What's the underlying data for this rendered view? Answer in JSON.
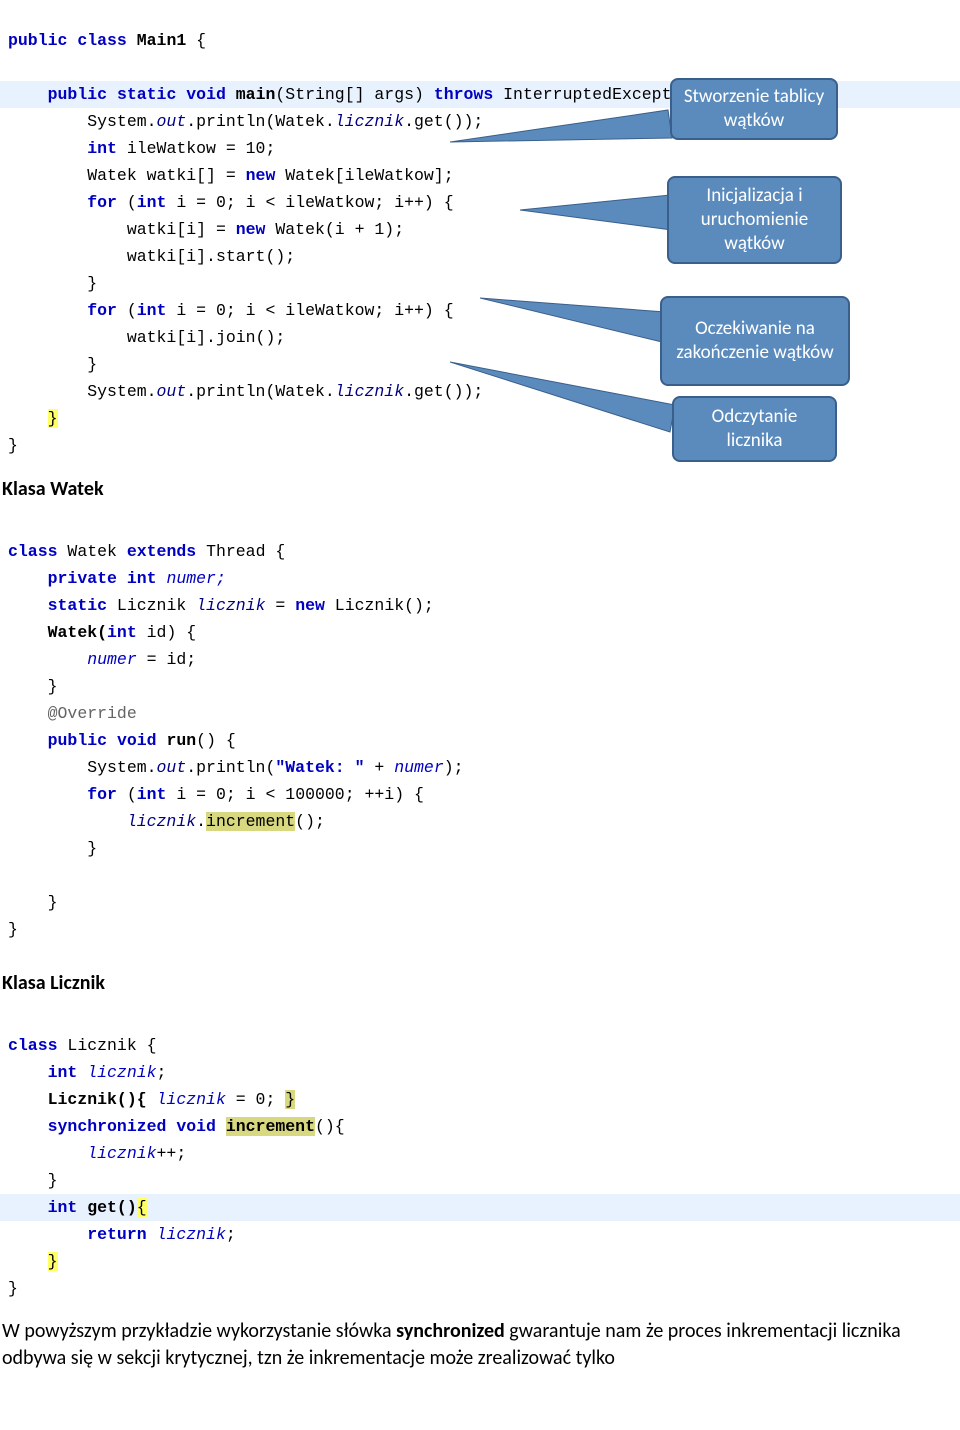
{
  "code_block_1": {
    "classDecl": {
      "kw1": "public",
      "kw2": "class",
      "name": "Main1"
    },
    "methodSig": {
      "kw1": "public",
      "kw2": "static",
      "kw3": "void",
      "name": "main",
      "argsPre": "(String[] args)",
      "throwsKw": "throws",
      "ex": "InterruptedException"
    },
    "l1": {
      "p1": "System.",
      "out": "out",
      "p2": ".println(Watek.",
      "lic": "licznik",
      "p3": ".get());"
    },
    "l2": {
      "kw": "int",
      "rest": " ileWatkow = 10;"
    },
    "l3": {
      "p1": "Watek watki[] = ",
      "kw": "new",
      "p2": " Watek[ileWatkow];"
    },
    "l4": {
      "kw1": "for",
      "p1": " (",
      "kw2": "int",
      "p2": " i = 0; i < ileWatkow; i++) {"
    },
    "l5": {
      "p1": "watki[i] = ",
      "kw": "new",
      "p2": " Watek(i + 1);"
    },
    "l6": {
      "txt": "watki[i].start();"
    },
    "l7": {
      "txt": "}"
    },
    "l8": {
      "kw1": "for",
      "p1": " (",
      "kw2": "int",
      "p2": " i = 0; i < ileWatkow; i++) {"
    },
    "l9": {
      "txt": "watki[i].join();"
    },
    "l10": {
      "txt": "}"
    },
    "l11": {
      "p1": "System.",
      "out": "out",
      "p2": ".println(Watek.",
      "lic": "licznik",
      "p3": ".get());"
    },
    "l12": {
      "txt": "}"
    },
    "l13": {
      "txt": "}"
    }
  },
  "section1": "Klasa Watek",
  "code_block_2": {
    "classDecl": {
      "kw": "class",
      "name": "Watek",
      "ext": "extends",
      "sup": "Thread"
    },
    "l1": {
      "kw1": "private",
      "kw2": "int",
      "name": " numer;"
    },
    "l2": {
      "kw": "static",
      "type": " Licznik ",
      "lic": "licznik",
      "rest": " = ",
      "kwNew": "new",
      "rest2": " Licznik();"
    },
    "l3": {
      "p1": "Watek(",
      "kw": "int",
      "p2": " id) {"
    },
    "l4": {
      "fld": "numer",
      "rest": " = id;"
    },
    "l5": {
      "txt": "}"
    },
    "l6": {
      "txt": "@Override"
    },
    "l7": {
      "kw1": "public",
      "kw2": "void",
      "name": "run",
      "rest": "() {"
    },
    "l8": {
      "p1": "System.",
      "out": "out",
      "p2": ".println(",
      "str": "\"Watek: \"",
      "p3": " + ",
      "fld": "numer",
      "p4": ");"
    },
    "l9": {
      "kw1": "for",
      "p1": " (",
      "kw2": "int",
      "p2": " i = 0; i < 100000; ++i) {"
    },
    "l10": {
      "lic": "licznik",
      "dot": ".",
      "inc": "increment",
      "rest": "();"
    },
    "l11": {
      "txt": "}"
    },
    "l12": {
      "txt": "}"
    },
    "l13": {
      "txt": "}"
    }
  },
  "section2": "Klasa Licznik",
  "code_block_3": {
    "classDecl": {
      "kw": "class",
      "name": "Licznik"
    },
    "l1": {
      "kw": "int",
      "fld": " licznik",
      "semi": ";"
    },
    "l2": {
      "p1": "Licznik(){ ",
      "fld": "licznik",
      "rest": " = 0; ",
      "close": "}"
    },
    "l3": {
      "kw1": "synchronized",
      "kw2": "void",
      "inc": "increment",
      "rest": "(){"
    },
    "l4": {
      "fld": "licznik",
      "rest": "++;"
    },
    "l5": {
      "txt": "}"
    },
    "l6": {
      "kw": "int",
      "name": " get()",
      "br": "{"
    },
    "l7": {
      "kw": "return",
      "fld": " licznik",
      "semi": ";"
    },
    "l8": {
      "txt": "}"
    },
    "l9": {
      "txt": "}"
    }
  },
  "callouts": {
    "c1": "Stworzenie tablicy wątków",
    "c2": "Inicjalizacja i uruchomienie wątków",
    "c3": "Oczekiwanie na zakończenie wątków",
    "c4": "Odczytanie licznika"
  },
  "paragraph": {
    "t1": "W powyższym przykładzie wykorzystanie słówka ",
    "b": "synchronized",
    "t2": " gwarantuje nam że proces inkrementacji licznika odbywa się w sekcji krytycznej, tzn że inkrementacje może zrealizować tylko"
  }
}
